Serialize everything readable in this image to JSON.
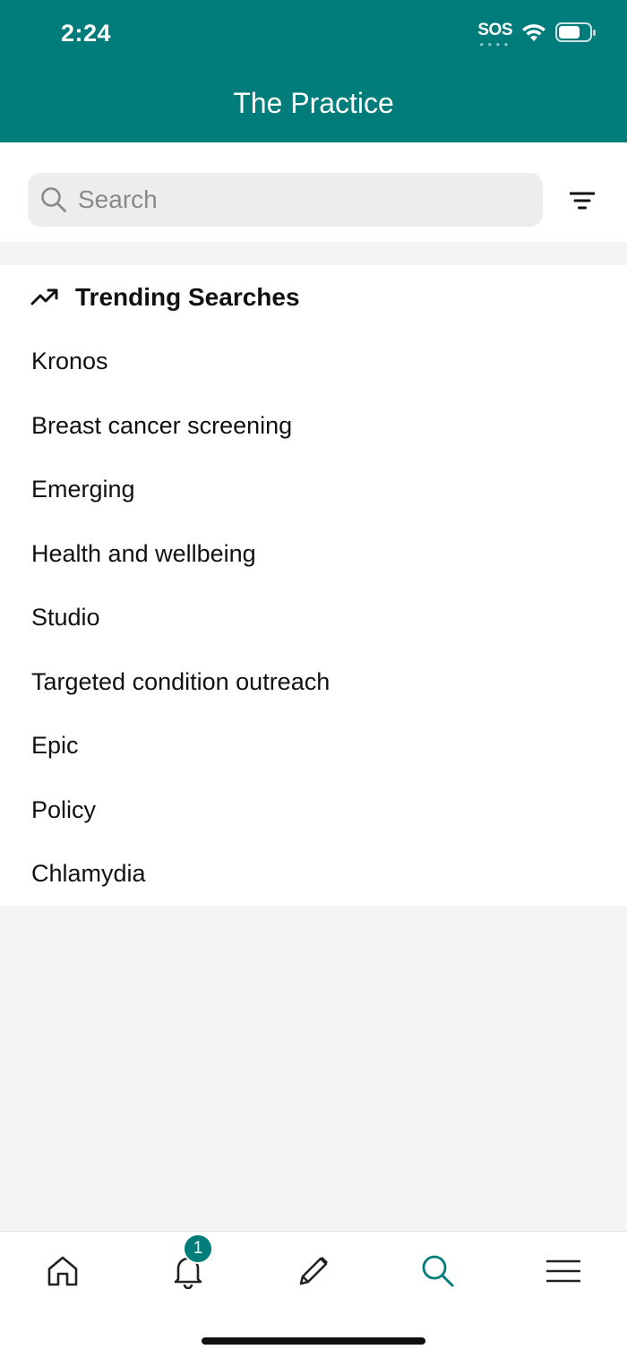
{
  "status_bar": {
    "time": "2:24",
    "sos": "SOS"
  },
  "header": {
    "title": "The Practice"
  },
  "search": {
    "placeholder": "Search"
  },
  "trending": {
    "title": "Trending Searches",
    "items": [
      "Kronos",
      "Breast cancer screening",
      "Emerging",
      "Health and wellbeing",
      "Studio",
      "Targeted condition outreach",
      "Epic",
      "Policy",
      "Chlamydia"
    ]
  },
  "tab_bar": {
    "notifications_badge": "1",
    "active_tab": "search",
    "tabs": [
      "home",
      "notifications",
      "compose",
      "search",
      "menu"
    ]
  },
  "colors": {
    "brand": "#007d7b",
    "background": "#f4f4f4"
  }
}
